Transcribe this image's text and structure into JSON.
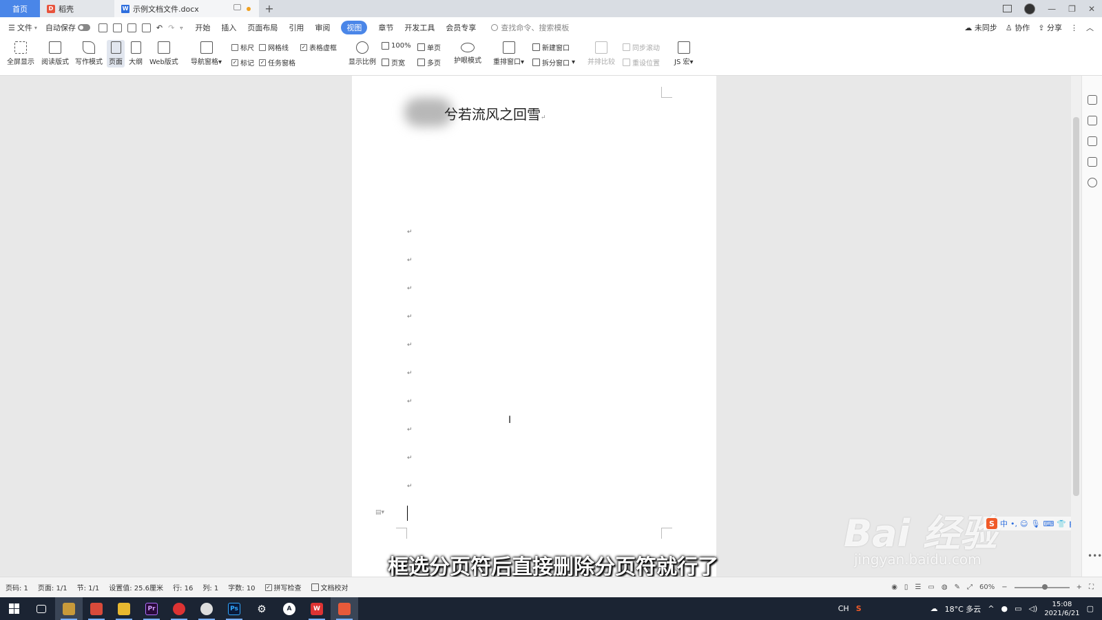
{
  "titlebar": {
    "home_tab": "首页",
    "daoke_tab": "稻壳",
    "doc_tab": "示例文档文件.docx",
    "add_tab": "+"
  },
  "menubar": {
    "file": "文件",
    "autosave": "自动保存",
    "tabs": [
      "开始",
      "插入",
      "页面布局",
      "引用",
      "审阅",
      "视图",
      "章节",
      "开发工具",
      "会员专享"
    ],
    "active_tab": "视图",
    "search_placeholder": "查找命令、搜索模板",
    "unsynced": "未同步",
    "collab": "协作",
    "share": "分享"
  },
  "ribbon": {
    "fullscreen": "全屏显示",
    "reading": "阅读版式",
    "writing": "写作模式",
    "page": "页面",
    "outline": "大纲",
    "web": "Web版式",
    "nav_pane": "导航窗格",
    "ruler": "标尺",
    "gridlines": "网格线",
    "table_gridlines": "表格虚框",
    "marks": "标记",
    "task_pane": "任务窗格",
    "zoom_ratio": "显示比例",
    "zoom_100": "100%",
    "single_page": "单页",
    "page_width": "页宽",
    "multi_page": "多页",
    "eye_mode": "护眼模式",
    "rearrange": "重排窗口",
    "new_window": "新建窗口",
    "split_window": "拆分窗口",
    "side_by_side": "并排比较",
    "sync_scroll": "同步滚动",
    "reset_position": "重设位置",
    "js_macro": "JS 宏"
  },
  "document": {
    "title": "兮若流风之回雪",
    "para_mark": "↵"
  },
  "subtitle": "框选分页符后直接删除分页符就行了",
  "watermark": {
    "main": "Bai 经验",
    "sub": "jingyan.baidu.com"
  },
  "ime": {
    "logo": "S",
    "mode": "中"
  },
  "statusbar": {
    "page_no": "页码: 1",
    "pages": "页面: 1/1",
    "section": "节: 1/1",
    "settings": "设置值: 25.6厘米",
    "row": "行: 16",
    "col": "列: 1",
    "words": "字数: 10",
    "spell_check": "拼写检查",
    "doc_proof": "文档校对",
    "zoom": "60%"
  },
  "taskbar": {
    "ime_indicator": "CH",
    "weather": "18°C 多云",
    "time": "15:08",
    "date": "2021/6/21"
  },
  "colors": {
    "accent": "#4a86e8",
    "taskbar": "#1b2433"
  }
}
